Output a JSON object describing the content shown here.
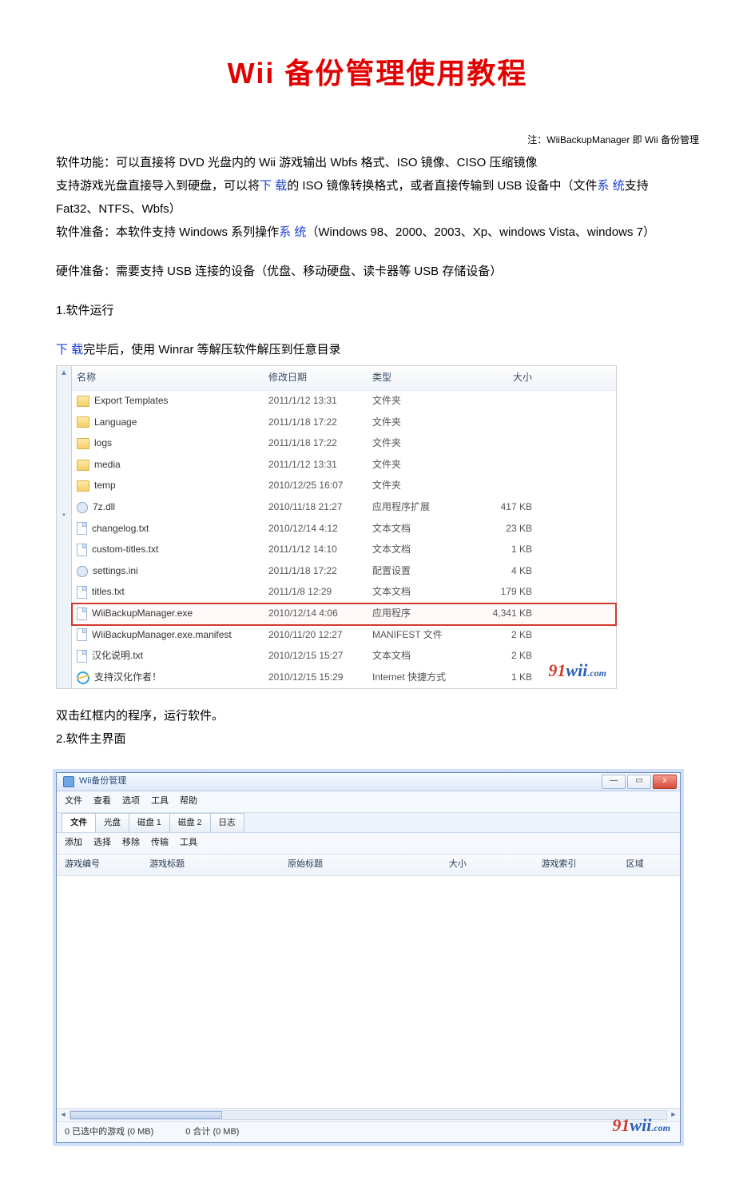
{
  "title": "Wii 备份管理使用教程",
  "note": "注：WiiBackupManager 即 Wii 备份管理",
  "intro": {
    "func_prefix": "软件功能：可以直接将 DVD 光盘内的 Wii 游戏输出 Wbfs 格式、ISO 镜像、CISO 压缩镜像",
    "line2_a": "支持游戏光盘直接导入到硬盘，可以将",
    "link_download1": "下 载",
    "line2_b": "的 ISO 镜像转换格式，或者直接传输到 USB 设备中（文件",
    "link_system1": "系 统",
    "line2_c": "支持",
    "line3": "Fat32、NTFS、Wbfs）",
    "prep_a": "软件准备：本软件支持 Windows 系列操作",
    "link_system2": "系 统",
    "prep_b": "（Windows 98、2000、2003、Xp、windows Vista、windows 7）",
    "hw": "硬件准备：需要支持 USB 连接的设备（优盘、移动硬盘、读卡器等 USB 存储设备）",
    "sec1": "1.软件运行",
    "dl_a_link": "下 载",
    "dl_b": "完毕后，使用 Winrar 等解压软件解压到任意目录"
  },
  "filelist": {
    "headers": {
      "name": "名称",
      "date": "修改日期",
      "type": "类型",
      "size": "大小"
    },
    "rows": [
      {
        "icon": "folder",
        "name": "Export Templates",
        "date": "2011/1/12 13:31",
        "type": "文件夹",
        "size": ""
      },
      {
        "icon": "folder",
        "name": "Language",
        "date": "2011/1/18 17:22",
        "type": "文件夹",
        "size": ""
      },
      {
        "icon": "folder",
        "name": "logs",
        "date": "2011/1/18 17:22",
        "type": "文件夹",
        "size": ""
      },
      {
        "icon": "folder",
        "name": "media",
        "date": "2011/1/12 13:31",
        "type": "文件夹",
        "size": ""
      },
      {
        "icon": "folder",
        "name": "temp",
        "date": "2010/12/25 16:07",
        "type": "文件夹",
        "size": ""
      },
      {
        "icon": "gear",
        "name": "7z.dll",
        "date": "2010/11/18 21:27",
        "type": "应用程序扩展",
        "size": "417 KB"
      },
      {
        "icon": "file",
        "name": "changelog.txt",
        "date": "2010/12/14 4:12",
        "type": "文本文档",
        "size": "23 KB"
      },
      {
        "icon": "file",
        "name": "custom-titles.txt",
        "date": "2011/1/12 14:10",
        "type": "文本文档",
        "size": "1 KB"
      },
      {
        "icon": "gear",
        "name": "settings.ini",
        "date": "2011/1/18 17:22",
        "type": "配置设置",
        "size": "4 KB"
      },
      {
        "icon": "file",
        "name": "titles.txt",
        "date": "2011/1/8 12:29",
        "type": "文本文档",
        "size": "179 KB"
      },
      {
        "icon": "file",
        "name": "WiiBackupManager.exe",
        "date": "2010/12/14 4:06",
        "type": "应用程序",
        "size": "4,341 KB",
        "highlight": true
      },
      {
        "icon": "file",
        "name": "WiiBackupManager.exe.manifest",
        "date": "2010/11/20 12:27",
        "type": "MANIFEST 文件",
        "size": "2 KB"
      },
      {
        "icon": "file",
        "name": "汉化说明.txt",
        "date": "2010/12/15 15:27",
        "type": "文本文档",
        "size": "2 KB"
      },
      {
        "icon": "ie",
        "name": "支持汉化作者！",
        "date": "2010/12/15 15:29",
        "type": "Internet 快捷方式",
        "size": "1 KB"
      }
    ],
    "watermark": {
      "n9": "91",
      "wii": "wii",
      "com": ".com"
    }
  },
  "after_filelist": {
    "line1": "双击红框内的程序，运行软件。",
    "sec2": "2.软件主界面"
  },
  "app": {
    "title": "Wii备份管理",
    "win_min": "—",
    "win_max": "▭",
    "win_close": "x",
    "menu": [
      "文件",
      "查看",
      "选项",
      "工具",
      "帮助"
    ],
    "tabs": [
      "文件",
      "光盘",
      "磁盘 1",
      "磁盘 2",
      "日志"
    ],
    "toolbar": [
      "添加",
      "选择",
      "移除",
      "传输",
      "工具"
    ],
    "cols": {
      "id": "游戏编号",
      "title": "游戏标题",
      "orig": "原始标题",
      "size": "大小",
      "idx": "游戏索引",
      "region": "区域"
    },
    "status": {
      "a": "0 已选中的游戏 (0 MB)",
      "b": "0 合计 (0 MB)"
    },
    "watermark": {
      "n9": "91",
      "wii": "wii",
      "com": ".com"
    }
  }
}
